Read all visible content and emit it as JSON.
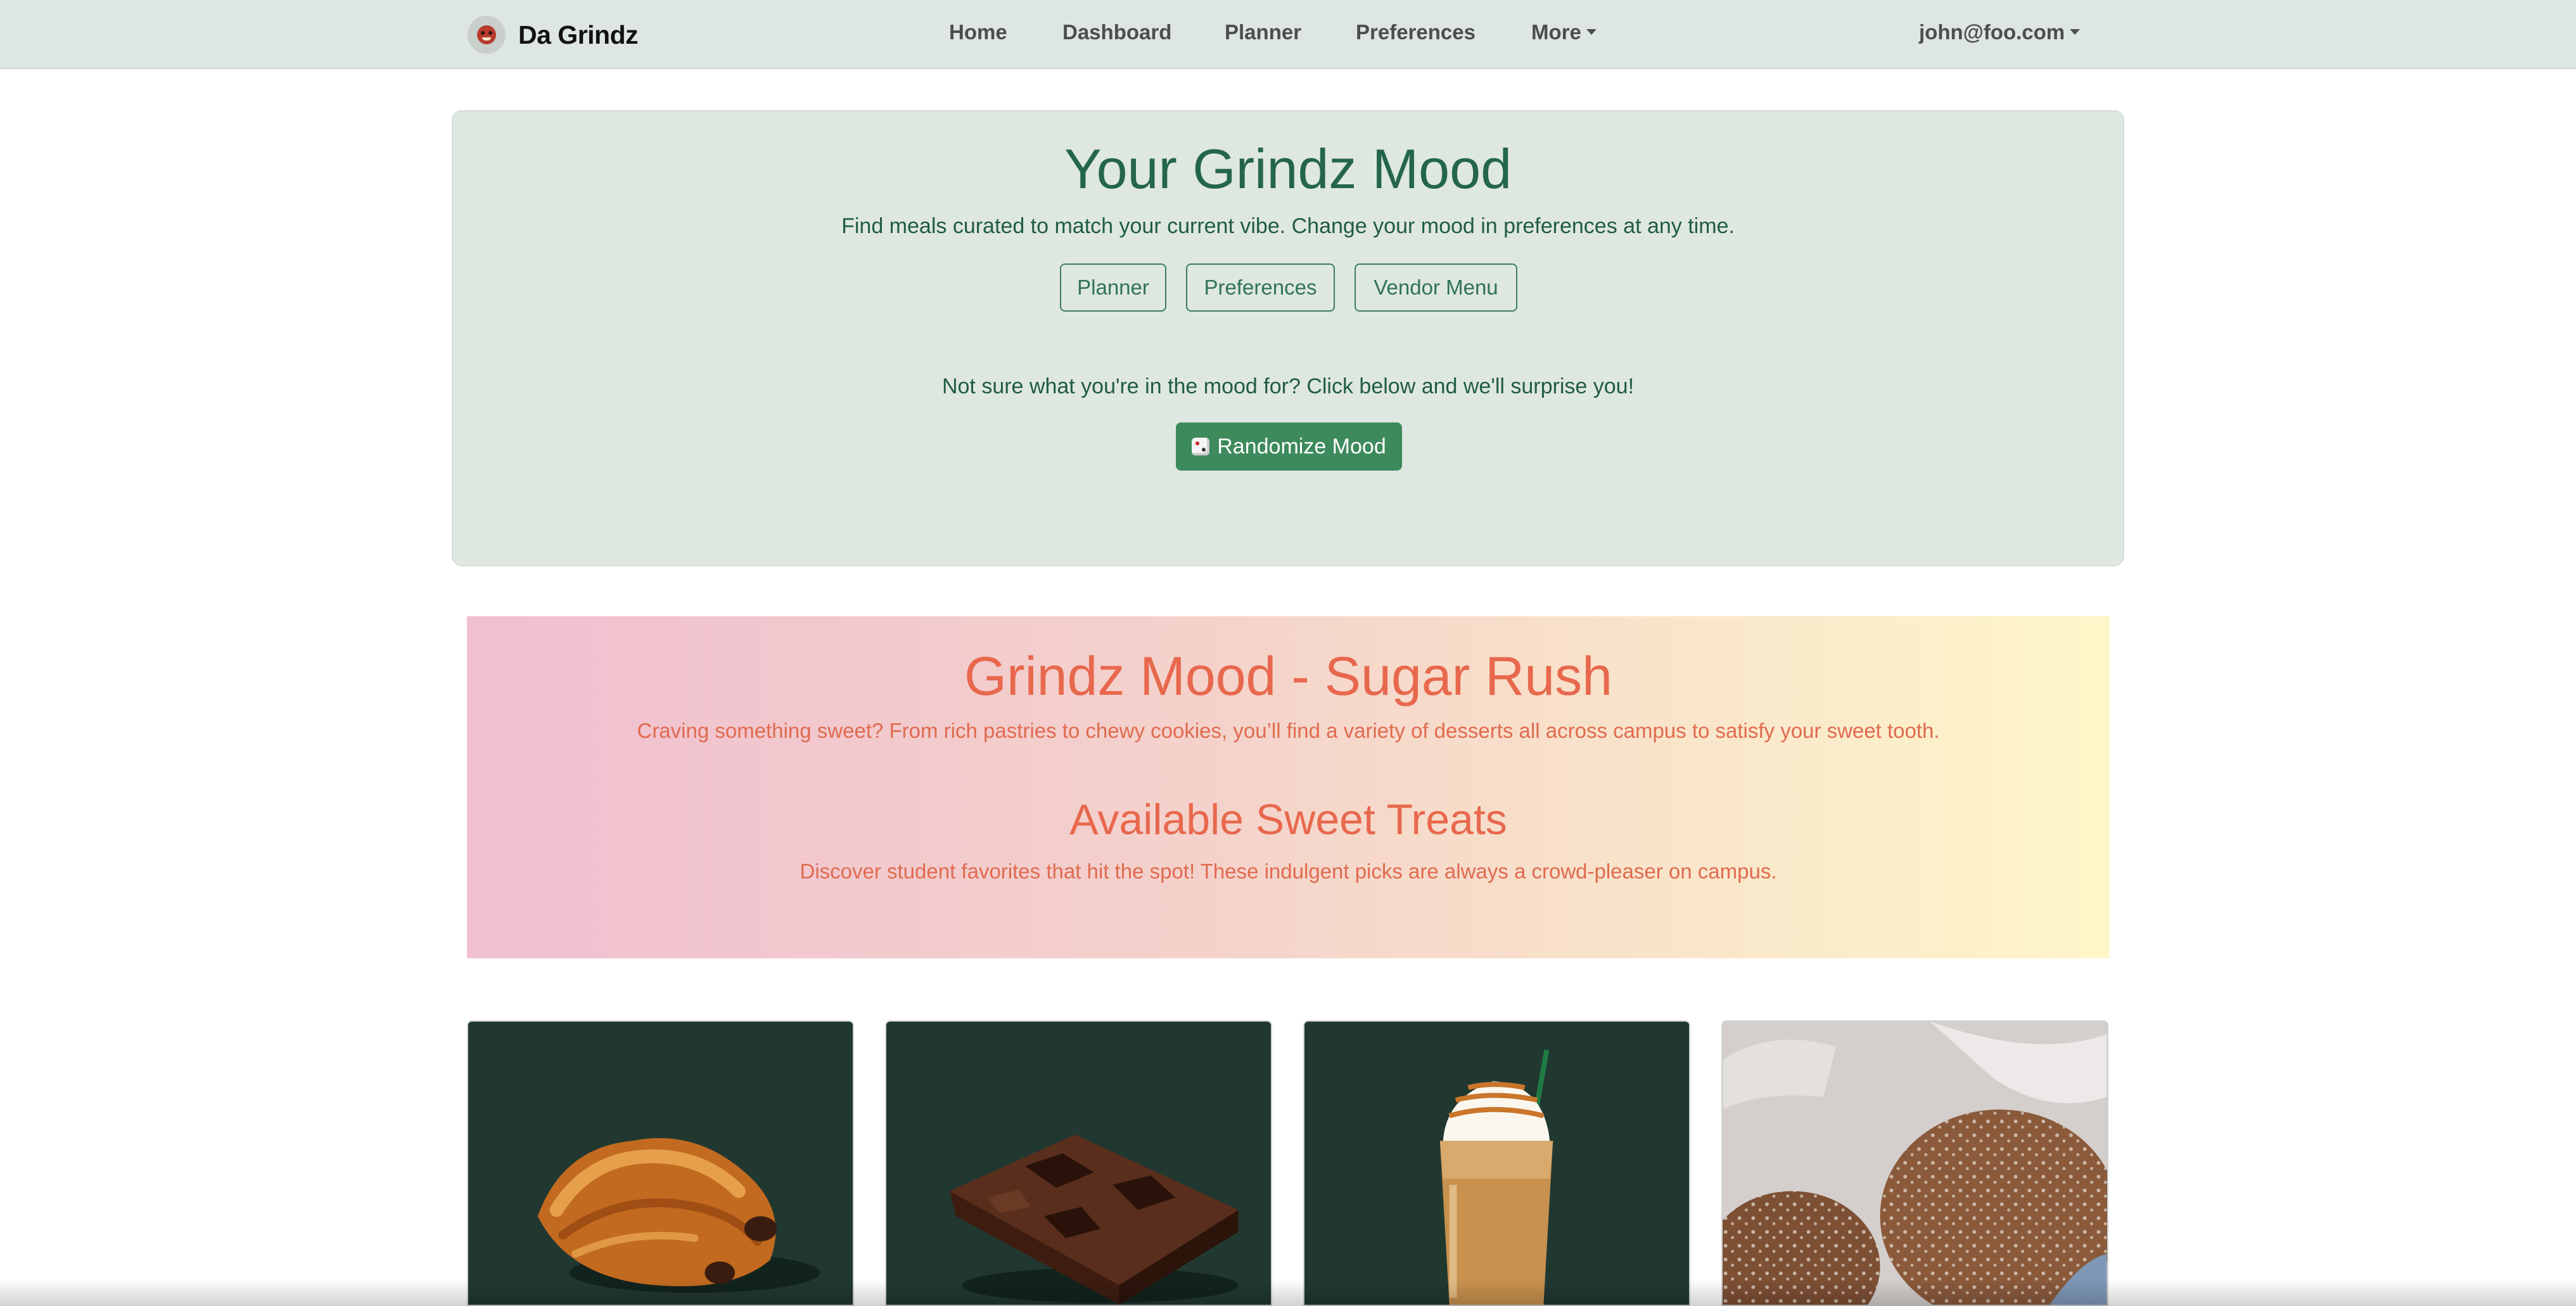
{
  "navbar": {
    "brand": "Da Grindz",
    "links": [
      "Home",
      "Dashboard",
      "Planner",
      "Preferences"
    ],
    "more": "More",
    "user": "john@foo.com"
  },
  "hero": {
    "title": "Your Grindz Mood",
    "subtitle": "Find meals curated to match your current vibe. Change your mood in preferences at any time.",
    "buttons": [
      "Planner",
      "Preferences",
      "Vendor Menu"
    ],
    "prompt": "Not sure what you're in the mood for? Click below and we'll surprise you!",
    "randomize_label": "Randomize Mood",
    "randomize_icon": "dice-icon"
  },
  "mood": {
    "title": "Grindz Mood - Sugar Rush",
    "description": "Craving something sweet? From rich pastries to chewy cookies, you’ll find a variety of desserts all across campus to satisfy your sweet tooth.",
    "section_title": "Available Sweet Treats",
    "section_description": "Discover student favorites that hit the spot! These indulgent picks are always a crowd-pleaser on campus."
  },
  "cards": [
    {
      "image": "chocolate-croissant-image"
    },
    {
      "image": "brownie-image"
    },
    {
      "image": "caramel-frappuccino-image"
    },
    {
      "image": "malasada-image"
    }
  ],
  "colors": {
    "navbar_bg": "#dde6e0",
    "hero_bg": "#dfe7e1",
    "accent_green": "#3d8a5c",
    "mood_text": "#e8684d",
    "card_dark": "#213831"
  }
}
